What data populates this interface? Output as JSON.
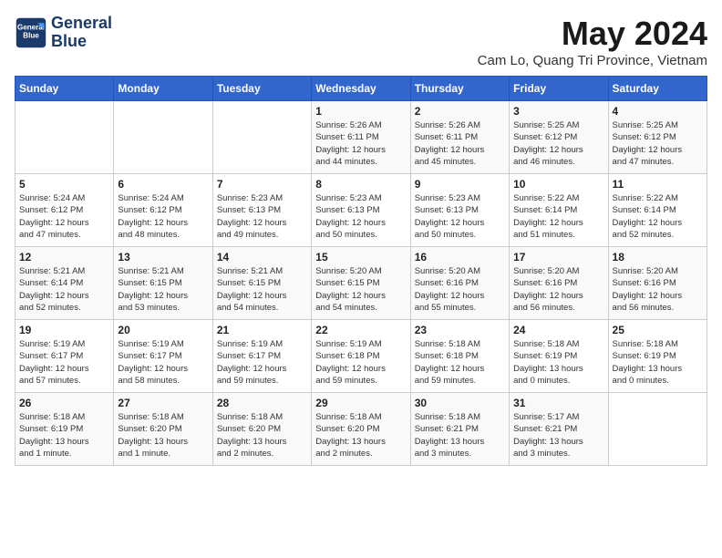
{
  "header": {
    "logo_line1": "General",
    "logo_line2": "Blue",
    "month": "May 2024",
    "location": "Cam Lo, Quang Tri Province, Vietnam"
  },
  "weekdays": [
    "Sunday",
    "Monday",
    "Tuesday",
    "Wednesday",
    "Thursday",
    "Friday",
    "Saturday"
  ],
  "weeks": [
    [
      {
        "day": "",
        "detail": ""
      },
      {
        "day": "",
        "detail": ""
      },
      {
        "day": "",
        "detail": ""
      },
      {
        "day": "1",
        "detail": "Sunrise: 5:26 AM\nSunset: 6:11 PM\nDaylight: 12 hours\nand 44 minutes."
      },
      {
        "day": "2",
        "detail": "Sunrise: 5:26 AM\nSunset: 6:11 PM\nDaylight: 12 hours\nand 45 minutes."
      },
      {
        "day": "3",
        "detail": "Sunrise: 5:25 AM\nSunset: 6:12 PM\nDaylight: 12 hours\nand 46 minutes."
      },
      {
        "day": "4",
        "detail": "Sunrise: 5:25 AM\nSunset: 6:12 PM\nDaylight: 12 hours\nand 47 minutes."
      }
    ],
    [
      {
        "day": "5",
        "detail": "Sunrise: 5:24 AM\nSunset: 6:12 PM\nDaylight: 12 hours\nand 47 minutes."
      },
      {
        "day": "6",
        "detail": "Sunrise: 5:24 AM\nSunset: 6:12 PM\nDaylight: 12 hours\nand 48 minutes."
      },
      {
        "day": "7",
        "detail": "Sunrise: 5:23 AM\nSunset: 6:13 PM\nDaylight: 12 hours\nand 49 minutes."
      },
      {
        "day": "8",
        "detail": "Sunrise: 5:23 AM\nSunset: 6:13 PM\nDaylight: 12 hours\nand 50 minutes."
      },
      {
        "day": "9",
        "detail": "Sunrise: 5:23 AM\nSunset: 6:13 PM\nDaylight: 12 hours\nand 50 minutes."
      },
      {
        "day": "10",
        "detail": "Sunrise: 5:22 AM\nSunset: 6:14 PM\nDaylight: 12 hours\nand 51 minutes."
      },
      {
        "day": "11",
        "detail": "Sunrise: 5:22 AM\nSunset: 6:14 PM\nDaylight: 12 hours\nand 52 minutes."
      }
    ],
    [
      {
        "day": "12",
        "detail": "Sunrise: 5:21 AM\nSunset: 6:14 PM\nDaylight: 12 hours\nand 52 minutes."
      },
      {
        "day": "13",
        "detail": "Sunrise: 5:21 AM\nSunset: 6:15 PM\nDaylight: 12 hours\nand 53 minutes."
      },
      {
        "day": "14",
        "detail": "Sunrise: 5:21 AM\nSunset: 6:15 PM\nDaylight: 12 hours\nand 54 minutes."
      },
      {
        "day": "15",
        "detail": "Sunrise: 5:20 AM\nSunset: 6:15 PM\nDaylight: 12 hours\nand 54 minutes."
      },
      {
        "day": "16",
        "detail": "Sunrise: 5:20 AM\nSunset: 6:16 PM\nDaylight: 12 hours\nand 55 minutes."
      },
      {
        "day": "17",
        "detail": "Sunrise: 5:20 AM\nSunset: 6:16 PM\nDaylight: 12 hours\nand 56 minutes."
      },
      {
        "day": "18",
        "detail": "Sunrise: 5:20 AM\nSunset: 6:16 PM\nDaylight: 12 hours\nand 56 minutes."
      }
    ],
    [
      {
        "day": "19",
        "detail": "Sunrise: 5:19 AM\nSunset: 6:17 PM\nDaylight: 12 hours\nand 57 minutes."
      },
      {
        "day": "20",
        "detail": "Sunrise: 5:19 AM\nSunset: 6:17 PM\nDaylight: 12 hours\nand 58 minutes."
      },
      {
        "day": "21",
        "detail": "Sunrise: 5:19 AM\nSunset: 6:17 PM\nDaylight: 12 hours\nand 59 minutes."
      },
      {
        "day": "22",
        "detail": "Sunrise: 5:19 AM\nSunset: 6:18 PM\nDaylight: 12 hours\nand 59 minutes."
      },
      {
        "day": "23",
        "detail": "Sunrise: 5:18 AM\nSunset: 6:18 PM\nDaylight: 12 hours\nand 59 minutes."
      },
      {
        "day": "24",
        "detail": "Sunrise: 5:18 AM\nSunset: 6:19 PM\nDaylight: 13 hours\nand 0 minutes."
      },
      {
        "day": "25",
        "detail": "Sunrise: 5:18 AM\nSunset: 6:19 PM\nDaylight: 13 hours\nand 0 minutes."
      }
    ],
    [
      {
        "day": "26",
        "detail": "Sunrise: 5:18 AM\nSunset: 6:19 PM\nDaylight: 13 hours\nand 1 minute."
      },
      {
        "day": "27",
        "detail": "Sunrise: 5:18 AM\nSunset: 6:20 PM\nDaylight: 13 hours\nand 1 minute."
      },
      {
        "day": "28",
        "detail": "Sunrise: 5:18 AM\nSunset: 6:20 PM\nDaylight: 13 hours\nand 2 minutes."
      },
      {
        "day": "29",
        "detail": "Sunrise: 5:18 AM\nSunset: 6:20 PM\nDaylight: 13 hours\nand 2 minutes."
      },
      {
        "day": "30",
        "detail": "Sunrise: 5:18 AM\nSunset: 6:21 PM\nDaylight: 13 hours\nand 3 minutes."
      },
      {
        "day": "31",
        "detail": "Sunrise: 5:17 AM\nSunset: 6:21 PM\nDaylight: 13 hours\nand 3 minutes."
      },
      {
        "day": "",
        "detail": ""
      }
    ]
  ]
}
